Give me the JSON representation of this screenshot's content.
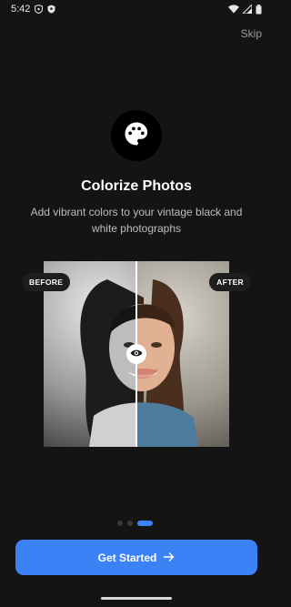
{
  "status_bar": {
    "time": "5:42"
  },
  "skip_label": "Skip",
  "feature": {
    "icon": "palette-icon",
    "title": "Colorize Photos",
    "subtitle": "Add vibrant colors to your vintage black and white photographs"
  },
  "comparison": {
    "before_label": "BEFORE",
    "after_label": "AFTER",
    "split_position": 0.5
  },
  "pagination": {
    "total": 3,
    "active_index": 2
  },
  "cta": {
    "label": "Get Started",
    "icon": "arrow-right-icon"
  },
  "colors": {
    "accent": "#3b82f6",
    "background": "#141414"
  }
}
